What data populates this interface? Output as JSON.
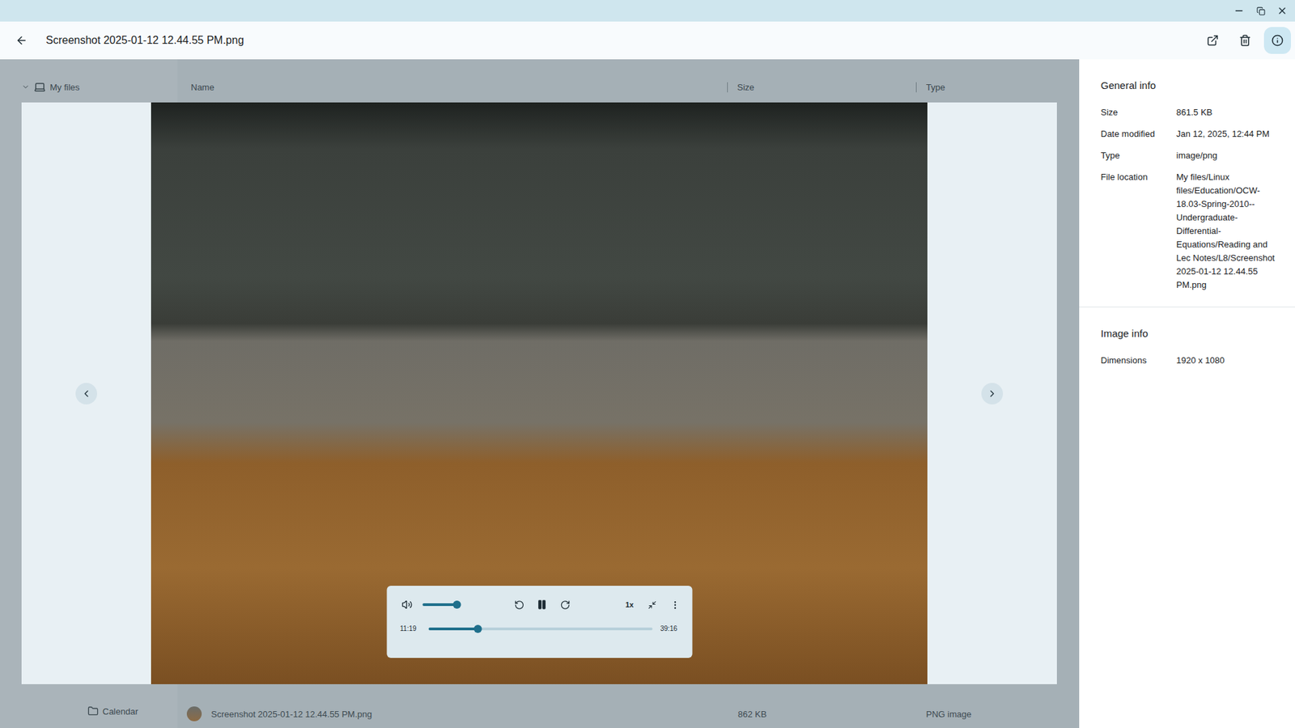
{
  "window": {
    "title": "Screenshot 2025-01-12 12.44.55 PM.png"
  },
  "toolbar": [
    {
      "kind": "open",
      "selected": false
    },
    {
      "kind": "delete",
      "selected": false
    },
    {
      "kind": "info",
      "selected": true
    }
  ],
  "file_manager": {
    "sidebar": [
      {
        "label": "My files",
        "kind": "root",
        "expanded": true
      },
      {
        "label": "Calendar",
        "kind": "folder",
        "expanded": false
      }
    ],
    "columns": [
      "Name",
      "Size",
      "Type"
    ],
    "rows": [
      {
        "name": "Screenshot 2025-01-12 12.44.55 PM.png",
        "size": "862 KB",
        "type": "PNG image"
      }
    ]
  },
  "player": {
    "playing": true,
    "volume_level": 0.9,
    "speed": "1x",
    "elapsed": "11:19",
    "duration": "39:16",
    "progress_level": 0.22
  },
  "info_panel": {
    "sections": [
      {
        "title": "General info",
        "rows": [
          {
            "label": "Size",
            "value": "861.5 KB"
          },
          {
            "label": "Date modified",
            "value": "Jan 12, 2025, 12:44 PM"
          },
          {
            "label": "Type",
            "value": "image/png"
          },
          {
            "label": "File location",
            "value": "My files/Linux files/Education/OCW-18.03-Spring-2010--Undergraduate-Differential-Equations/Reading and Lec Notes/L8/Screenshot 2025-01-12 12.44.55 PM.png"
          }
        ]
      },
      {
        "title": "Image info",
        "rows": [
          {
            "label": "Dimensions",
            "value": "1920 x 1080"
          }
        ]
      }
    ]
  }
}
